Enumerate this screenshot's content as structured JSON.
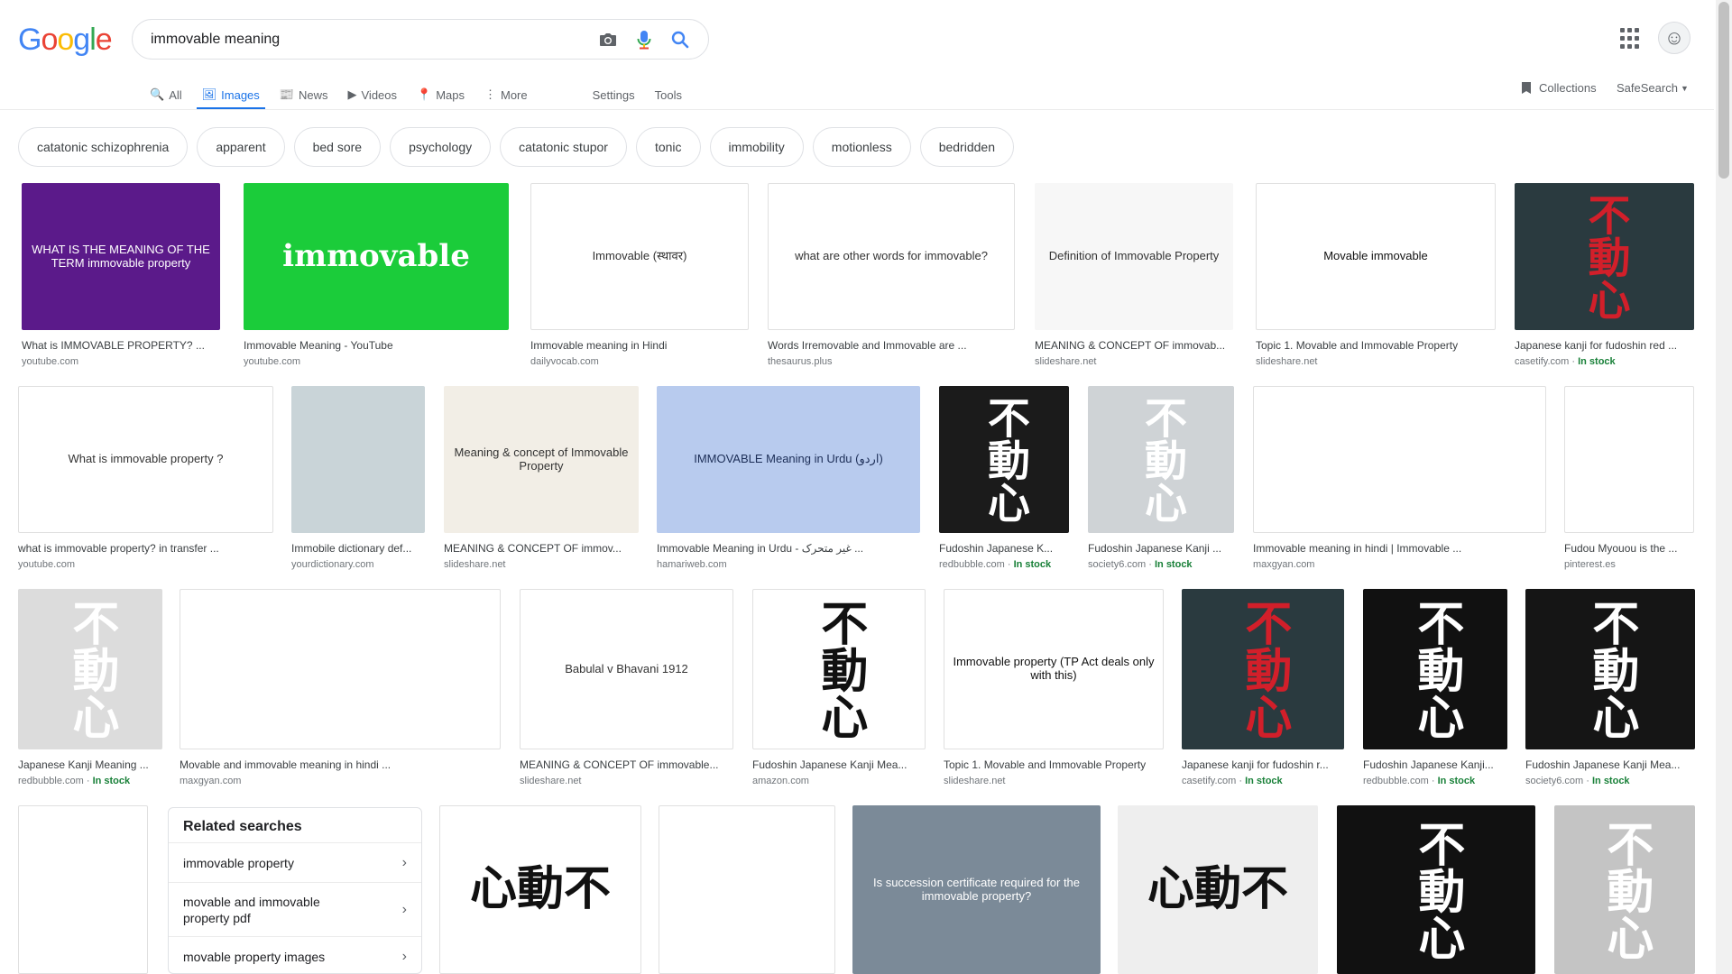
{
  "logo": {
    "letters": [
      "G",
      "o",
      "o",
      "g",
      "l",
      "e"
    ],
    "colors": [
      "#4285F4",
      "#EA4335",
      "#FBBC05",
      "#4285F4",
      "#34A853",
      "#EA4335"
    ]
  },
  "search": {
    "value": "immovable meaning"
  },
  "icons": {
    "camera": "camera-icon",
    "mic": "microphone-icon",
    "search": "search-icon",
    "apps": "apps-grid-icon"
  },
  "tabs": [
    {
      "label": "All",
      "icon": "🔍"
    },
    {
      "label": "Images",
      "icon": "🖼"
    },
    {
      "label": "News",
      "icon": "📰"
    },
    {
      "label": "Videos",
      "icon": "▶"
    },
    {
      "label": "Maps",
      "icon": "📍"
    },
    {
      "label": "More",
      "icon": "⋮"
    }
  ],
  "tools": {
    "settings": "Settings",
    "tools": "Tools"
  },
  "header_right": {
    "collections": "Collections",
    "safesearch": "SafeSearch"
  },
  "chips": [
    "catatonic schizophrenia",
    "apparent",
    "bed sore",
    "psychology",
    "catatonic stupor",
    "tonic",
    "immobility",
    "motionless",
    "bedridden"
  ],
  "rows": [
    [
      {
        "title": "What is IMMOVABLE PROPERTY? ...",
        "source": "youtube.com",
        "stock": "",
        "thumb_text": "WHAT IS THE MEANING OF THE TERM immovable property",
        "bg": "#5b1a8a",
        "fg": "#ffffff"
      },
      {
        "title": "Immovable Meaning - YouTube",
        "source": "youtube.com",
        "stock": "",
        "thumb_text": "immovable",
        "bg": "#1bcc3a",
        "fg": "#ffffff"
      },
      {
        "title": "Immovable meaning in Hindi",
        "source": "dailyvocab.com",
        "stock": "",
        "thumb_text": "Immovable (स्थावर)",
        "bg": "#ffffff",
        "fg": "#333333"
      },
      {
        "title": "Words Irremovable and Immovable are ...",
        "source": "thesaurus.plus",
        "stock": "",
        "thumb_text": "what are other words for immovable?",
        "bg": "#ffffff",
        "fg": "#333333"
      },
      {
        "title": "MEANING & CONCEPT OF immovab...",
        "source": "slideshare.net",
        "stock": "",
        "thumb_text": "Definition of Immovable Property",
        "bg": "#f7f7f7",
        "fg": "#333333"
      },
      {
        "title": "Topic 1. Movable and Immovable Property",
        "source": "slideshare.net",
        "stock": "",
        "thumb_text": "Movable    immovable",
        "bg": "#ffffff",
        "fg": "#111111"
      },
      {
        "title": "Japanese kanji for fudoshin red ...",
        "source": "casetify.com",
        "stock": "In stock",
        "thumb_text": "不動心",
        "bg": "#2a3a3f",
        "fg": "#d21f2a"
      }
    ],
    [
      {
        "title": "what is immovable property? in transfer ...",
        "source": "youtube.com",
        "stock": "",
        "thumb_text": "What is immovable property ?",
        "bg": "#ffffff",
        "fg": "#333333"
      },
      {
        "title": "Immobile dictionary def...",
        "source": "yourdictionary.com",
        "stock": "",
        "thumb_text": "",
        "bg": "#c9d4d8",
        "fg": "#333333"
      },
      {
        "title": "MEANING & CONCEPT OF immov...",
        "source": "slideshare.net",
        "stock": "",
        "thumb_text": "Meaning & concept of Immovable Property",
        "bg": "#f2eee6",
        "fg": "#333333"
      },
      {
        "title": "Immovable Meaning in Urdu - غیر متحرک ...",
        "source": "hamariweb.com",
        "stock": "",
        "thumb_text": "IMMOVABLE Meaning in Urdu (اردو)",
        "bg": "#b8cbee",
        "fg": "#1c2e57"
      },
      {
        "title": "Fudoshin Japanese K...",
        "source": "redbubble.com",
        "stock": "In stock",
        "thumb_text": "不動心",
        "bg": "#1b1b1b",
        "fg": "#ffffff"
      },
      {
        "title": "Fudoshin Japanese Kanji ...",
        "source": "society6.com",
        "stock": "In stock",
        "thumb_text": "不動心",
        "bg": "#cfd3d6",
        "fg": "#ffffff"
      },
      {
        "title": "Immovable meaning in hindi | Immovable ...",
        "source": "maxgyan.com",
        "stock": "",
        "thumb_text": "",
        "bg": "#ffffff",
        "fg": "#333333"
      },
      {
        "title": "Fudou Myouou is the ...",
        "source": "pinterest.es",
        "stock": "",
        "thumb_text": "",
        "bg": "#ffffff",
        "fg": "#333333"
      }
    ],
    [
      {
        "title": "Japanese Kanji Meaning ...",
        "source": "redbubble.com",
        "stock": "In stock",
        "thumb_text": "不動心",
        "bg": "#dcdcdc",
        "fg": "#ffffff"
      },
      {
        "title": "Movable and immovable meaning in hindi ...",
        "source": "maxgyan.com",
        "stock": "",
        "thumb_text": "",
        "bg": "#ffffff",
        "fg": "#333333"
      },
      {
        "title": "MEANING & CONCEPT OF immovable...",
        "source": "slideshare.net",
        "stock": "",
        "thumb_text": "Babulal v Bhavani 1912",
        "bg": "#ffffff",
        "fg": "#333333"
      },
      {
        "title": "Fudoshin Japanese Kanji Mea...",
        "source": "amazon.com",
        "stock": "",
        "thumb_text": "不動心",
        "bg": "#ffffff",
        "fg": "#111111"
      },
      {
        "title": "Topic 1. Movable and Immovable Property",
        "source": "slideshare.net",
        "stock": "",
        "thumb_text": "Immovable property (TP Act deals only with this)",
        "bg": "#ffffff",
        "fg": "#111111"
      },
      {
        "title": "Japanese kanji for fudoshin r...",
        "source": "casetify.com",
        "stock": "In stock",
        "thumb_text": "不動心",
        "bg": "#2a3a3f",
        "fg": "#d21f2a"
      },
      {
        "title": "Fudoshin Japanese Kanji...",
        "source": "redbubble.com",
        "stock": "In stock",
        "thumb_text": "不動心",
        "bg": "#111111",
        "fg": "#ffffff"
      },
      {
        "title": "Fudoshin Japanese Kanji Mea...",
        "source": "society6.com",
        "stock": "In stock",
        "thumb_text": "不動心",
        "bg": "#151515",
        "fg": "#ffffff"
      }
    ],
    [
      {
        "title": "",
        "source": "",
        "stock": "",
        "thumb_text": "",
        "bg": "#ffffff",
        "fg": "#333333"
      },
      {
        "title": "",
        "source": "",
        "stock": "",
        "thumb_text": "心動不",
        "bg": "#ffffff",
        "fg": "#111111"
      },
      {
        "title": "",
        "source": "",
        "stock": "",
        "thumb_text": "",
        "bg": "#ffffff",
        "fg": "#333333"
      },
      {
        "title": "",
        "source": "",
        "stock": "",
        "thumb_text": "Is succession certificate required for the immovable property?",
        "bg": "#7b8a98",
        "fg": "#ffffff"
      },
      {
        "title": "",
        "source": "",
        "stock": "",
        "thumb_text": "心動不",
        "bg": "#eeeeee",
        "fg": "#111111"
      },
      {
        "title": "",
        "source": "",
        "stock": "",
        "thumb_text": "不動心",
        "bg": "#111111",
        "fg": "#ffffff"
      },
      {
        "title": "",
        "source": "",
        "stock": "",
        "thumb_text": "不動心",
        "bg": "#c4c4c4",
        "fg": "#ffffff"
      }
    ]
  ],
  "related": {
    "heading": "Related searches",
    "items": [
      "immovable property",
      "movable and immovable property pdf",
      "movable property images"
    ]
  },
  "colors": {
    "accent": "#1a73e8",
    "stock": "#188038"
  }
}
